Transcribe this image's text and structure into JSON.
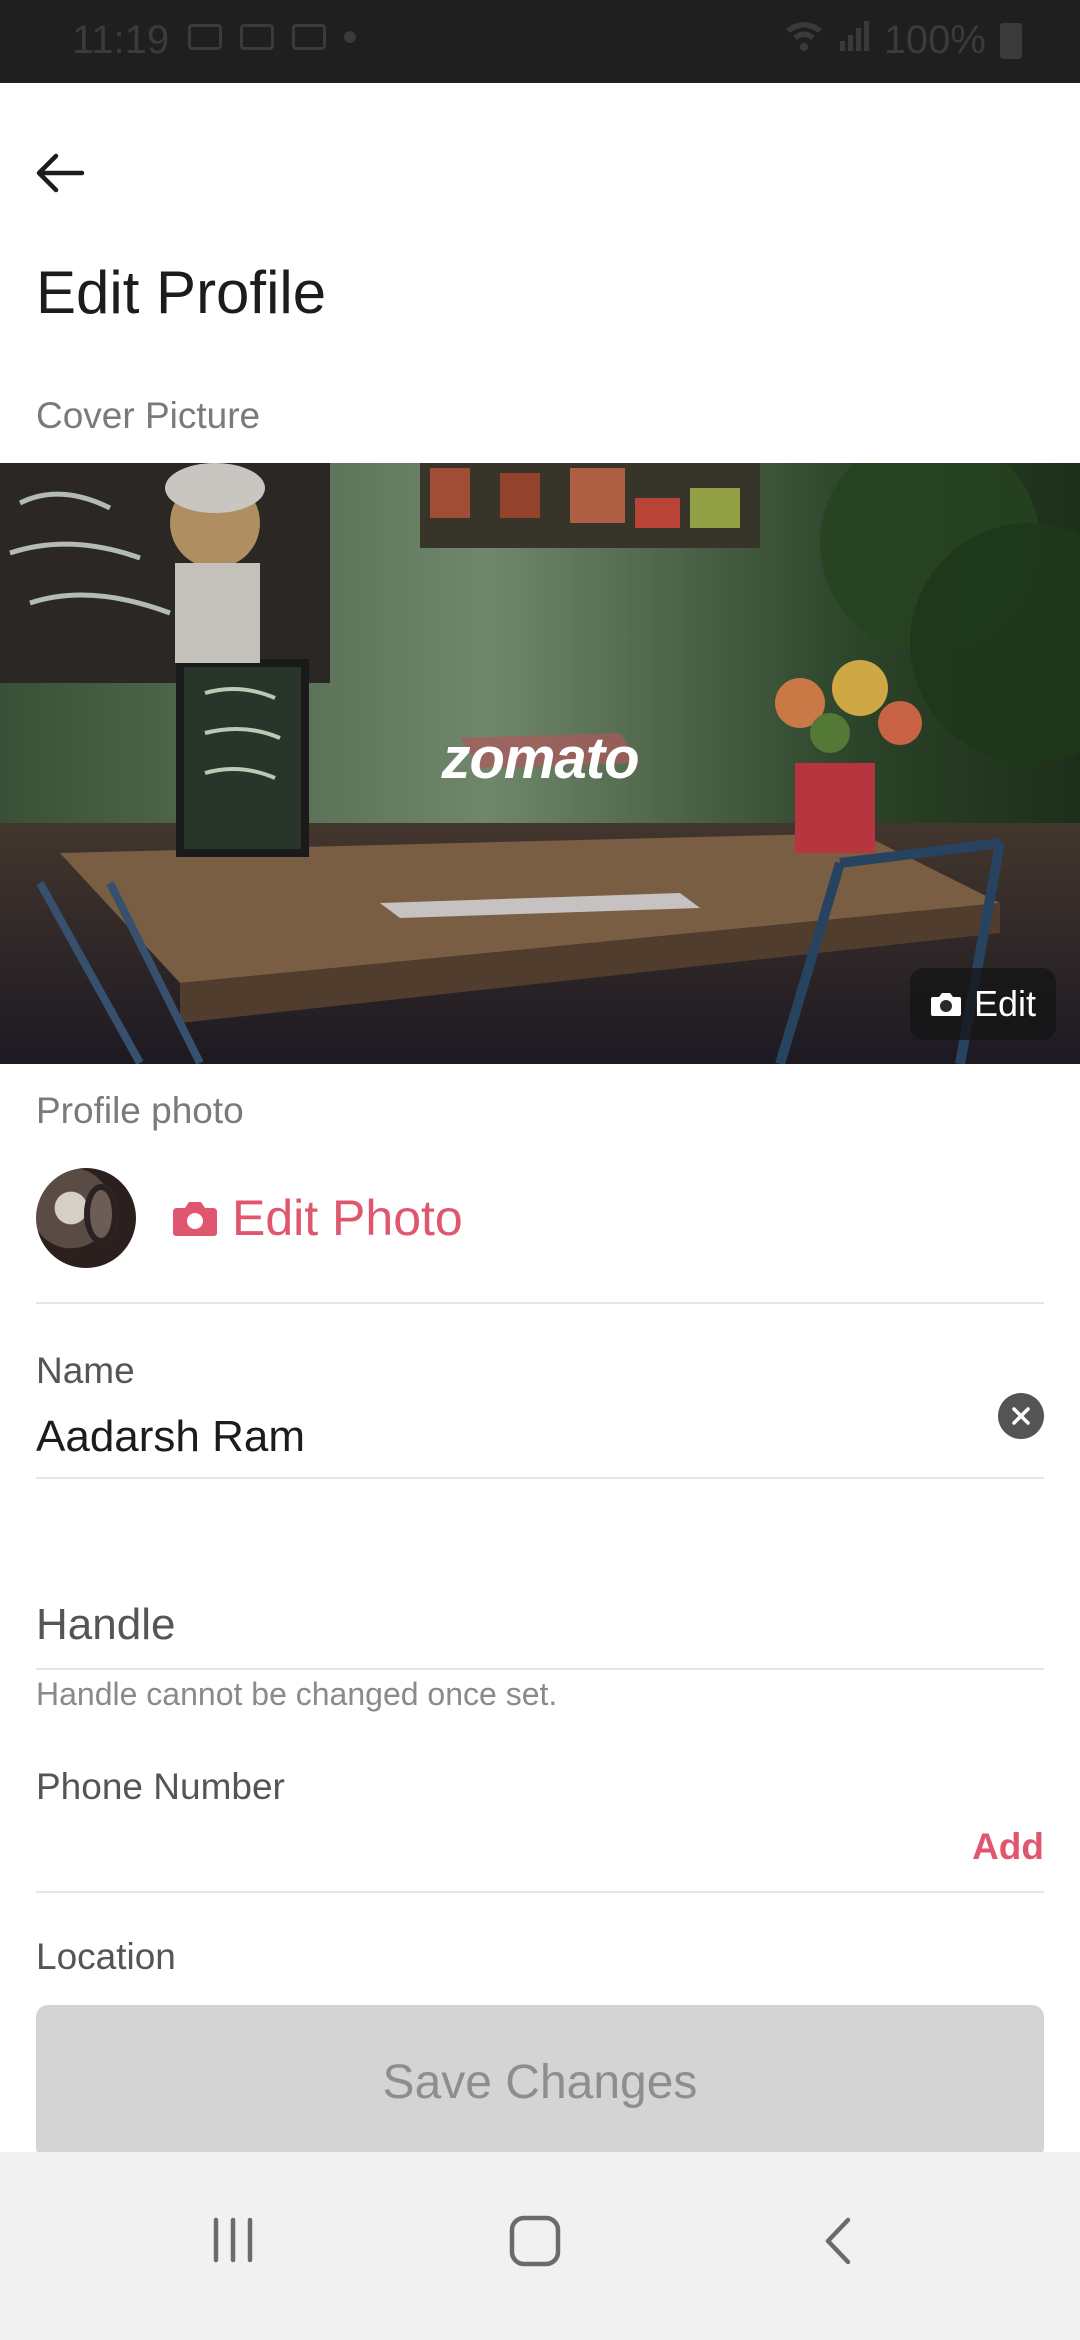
{
  "status_bar": {
    "time": "11:19",
    "battery": "100%"
  },
  "header": {
    "title": "Edit Profile"
  },
  "cover": {
    "label": "Cover Picture",
    "brand": "zomato",
    "edit_label": "Edit"
  },
  "profile": {
    "label": "Profile photo",
    "edit_photo_label": "Edit Photo"
  },
  "form": {
    "name_label": "Name",
    "name_value": "Aadarsh Ram",
    "handle_placeholder": "Handle",
    "handle_hint": "Handle cannot be changed once set.",
    "phone_label": "Phone Number",
    "phone_action": "Add",
    "location_label": "Location"
  },
  "actions": {
    "save_label": "Save Changes"
  },
  "colors": {
    "accent": "#e0566f",
    "button_disabled": "#d4d4d4"
  },
  "icons": [
    "back-arrow-icon",
    "camera-icon",
    "clear-icon",
    "recent-apps-icon",
    "home-icon",
    "back-nav-icon"
  ]
}
